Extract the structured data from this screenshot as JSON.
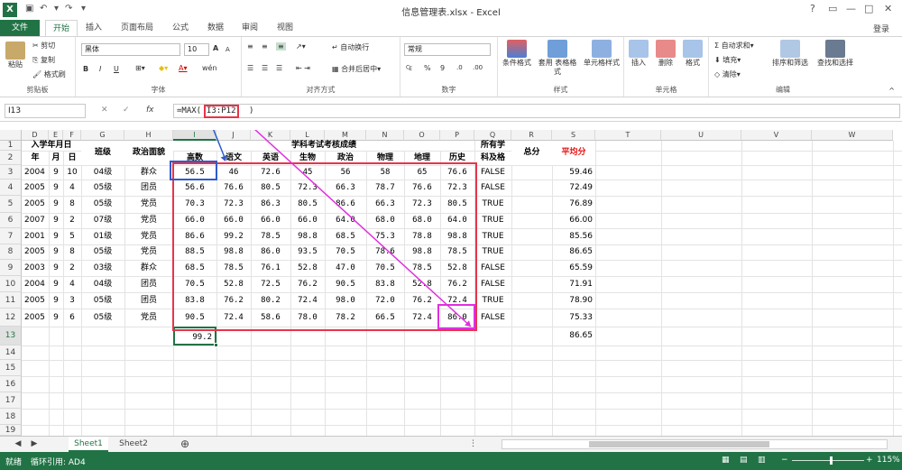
{
  "app": {
    "title": "信息管理表.xlsx - Excel",
    "logo": "X",
    "quick_access": [
      "save-icon",
      "undo-icon",
      "redo-icon"
    ],
    "window_controls": [
      "?",
      "▢",
      "—",
      "□",
      "✕"
    ]
  },
  "tabs": {
    "file": "文件",
    "items": [
      "开始",
      "插入",
      "页面布局",
      "公式",
      "数据",
      "审阅",
      "视图"
    ],
    "active": "开始",
    "login": "登录"
  },
  "ribbon": {
    "clipboard": {
      "label": "剪贴板",
      "paste": "粘贴",
      "cut": "剪切",
      "copy": "复制",
      "format_painter": "格式刷"
    },
    "font": {
      "label": "字体",
      "name": "黑体",
      "size": "10",
      "bold": "B",
      "italic": "I",
      "underline": "U",
      "grow": "A",
      "shrink": "A",
      "wen": "wén"
    },
    "alignment": {
      "label": "对齐方式",
      "wrap": "自动换行",
      "merge": "合并后居中"
    },
    "number": {
      "label": "数字",
      "format": "常规",
      "currency": "₠",
      "percent": "%",
      "comma": "9",
      "inc": ".0",
      "dec": ".00"
    },
    "styles": {
      "label": "样式",
      "conditional": "条件格式",
      "table": "套用\n表格格式",
      "cell_styles": "单元格样式"
    },
    "cells": {
      "label": "单元格",
      "insert": "插入",
      "delete": "删除",
      "format": "格式"
    },
    "editing": {
      "label": "编辑",
      "autosum": "自动求和",
      "fill": "填充",
      "clear": "清除",
      "sort": "排序和筛选",
      "find": "查找和选择"
    }
  },
  "formula_bar": {
    "name_box": "I13",
    "cancel": "✕",
    "enter": "✓",
    "fx": "fx",
    "formula_prefix": "=MAX(",
    "formula_range": "I3:P12",
    "formula_suffix": ")"
  },
  "sheet": {
    "col_letters": [
      "D",
      "E",
      "F",
      "G",
      "H",
      "I",
      "J",
      "K",
      "L",
      "M",
      "N",
      "O",
      "P",
      "Q",
      "R",
      "S",
      "T",
      "U",
      "V",
      "W"
    ],
    "selected_col": "I",
    "row_numbers": [
      "1",
      "2",
      "3",
      "4",
      "5",
      "6",
      "7",
      "8",
      "9",
      "10",
      "11",
      "12",
      "13",
      "14",
      "15",
      "16",
      "17",
      "18",
      "19",
      "20"
    ],
    "selected_row": "13",
    "headers": {
      "enroll": "入学年月日",
      "year": "年",
      "month": "月",
      "day": "日",
      "class": "班级",
      "politics": "政治面貌",
      "subjects": "学科考试考核成绩",
      "gaoshu": "高数",
      "yuwen": "语文",
      "yingyu": "英语",
      "shengwu": "生物",
      "zhengzhi": "政治",
      "wuli": "物理",
      "dili": "地理",
      "lishi": "历史",
      "all_pass_1": "所有学",
      "all_pass_2": "科及格",
      "total": "总分",
      "average": "平均分"
    },
    "rows": [
      [
        "2004",
        "9",
        "10",
        "04级",
        "群众",
        "56.5",
        "46",
        "72.6",
        "45",
        "56",
        "58",
        "65",
        "76.6",
        "FALSE",
        "",
        "59.46"
      ],
      [
        "2005",
        "9",
        "4",
        "05级",
        "团员",
        "56.6",
        "76.6",
        "80.5",
        "72.3",
        "66.3",
        "78.7",
        "76.6",
        "72.3",
        "FALSE",
        "",
        "72.49"
      ],
      [
        "2005",
        "9",
        "8",
        "05级",
        "党员",
        "70.3",
        "72.3",
        "86.3",
        "80.5",
        "86.6",
        "66.3",
        "72.3",
        "80.5",
        "TRUE",
        "",
        "76.89"
      ],
      [
        "2007",
        "9",
        "2",
        "07级",
        "党员",
        "66.0",
        "66.0",
        "66.0",
        "66.0",
        "64.0",
        "68.0",
        "68.0",
        "64.0",
        "TRUE",
        "",
        "66.00"
      ],
      [
        "2001",
        "9",
        "5",
        "01级",
        "党员",
        "86.6",
        "99.2",
        "78.5",
        "98.8",
        "68.5",
        "75.3",
        "78.8",
        "98.8",
        "TRUE",
        "",
        "85.56"
      ],
      [
        "2005",
        "9",
        "8",
        "05级",
        "党员",
        "88.5",
        "98.8",
        "86.0",
        "93.5",
        "70.5",
        "78.6",
        "98.8",
        "78.5",
        "TRUE",
        "",
        "86.65"
      ],
      [
        "2003",
        "9",
        "2",
        "03级",
        "群众",
        "68.5",
        "78.5",
        "76.1",
        "52.8",
        "47.0",
        "70.5",
        "78.5",
        "52.8",
        "FALSE",
        "",
        "65.59"
      ],
      [
        "2004",
        "9",
        "4",
        "04级",
        "团员",
        "70.5",
        "52.8",
        "72.5",
        "76.2",
        "90.5",
        "83.8",
        "52.8",
        "76.2",
        "FALSE",
        "",
        "71.91"
      ],
      [
        "2005",
        "9",
        "3",
        "05级",
        "团员",
        "83.8",
        "76.2",
        "80.2",
        "72.4",
        "98.0",
        "72.0",
        "76.2",
        "72.4",
        "TRUE",
        "",
        "78.90"
      ],
      [
        "2005",
        "9",
        "6",
        "05级",
        "党员",
        "90.5",
        "72.4",
        "58.6",
        "78.0",
        "78.2",
        "66.5",
        "72.4",
        "86.0",
        "FALSE",
        "",
        "75.33"
      ]
    ],
    "row13": {
      "result": "99.2",
      "average": "86.65"
    }
  },
  "sheet_tabs": {
    "tabs": [
      "Sheet1",
      "Sheet2"
    ],
    "active": "Sheet1",
    "add": "⊕"
  },
  "status_bar": {
    "ready": "就绪",
    "circular": "循环引用: AD4",
    "zoom": "115%",
    "minus": "−",
    "plus": "+"
  },
  "colors": {
    "accent": "#217346",
    "red": "#e8344a",
    "blue": "#2d5ccd",
    "magenta": "#e030e0",
    "average_header": "#e81010"
  }
}
